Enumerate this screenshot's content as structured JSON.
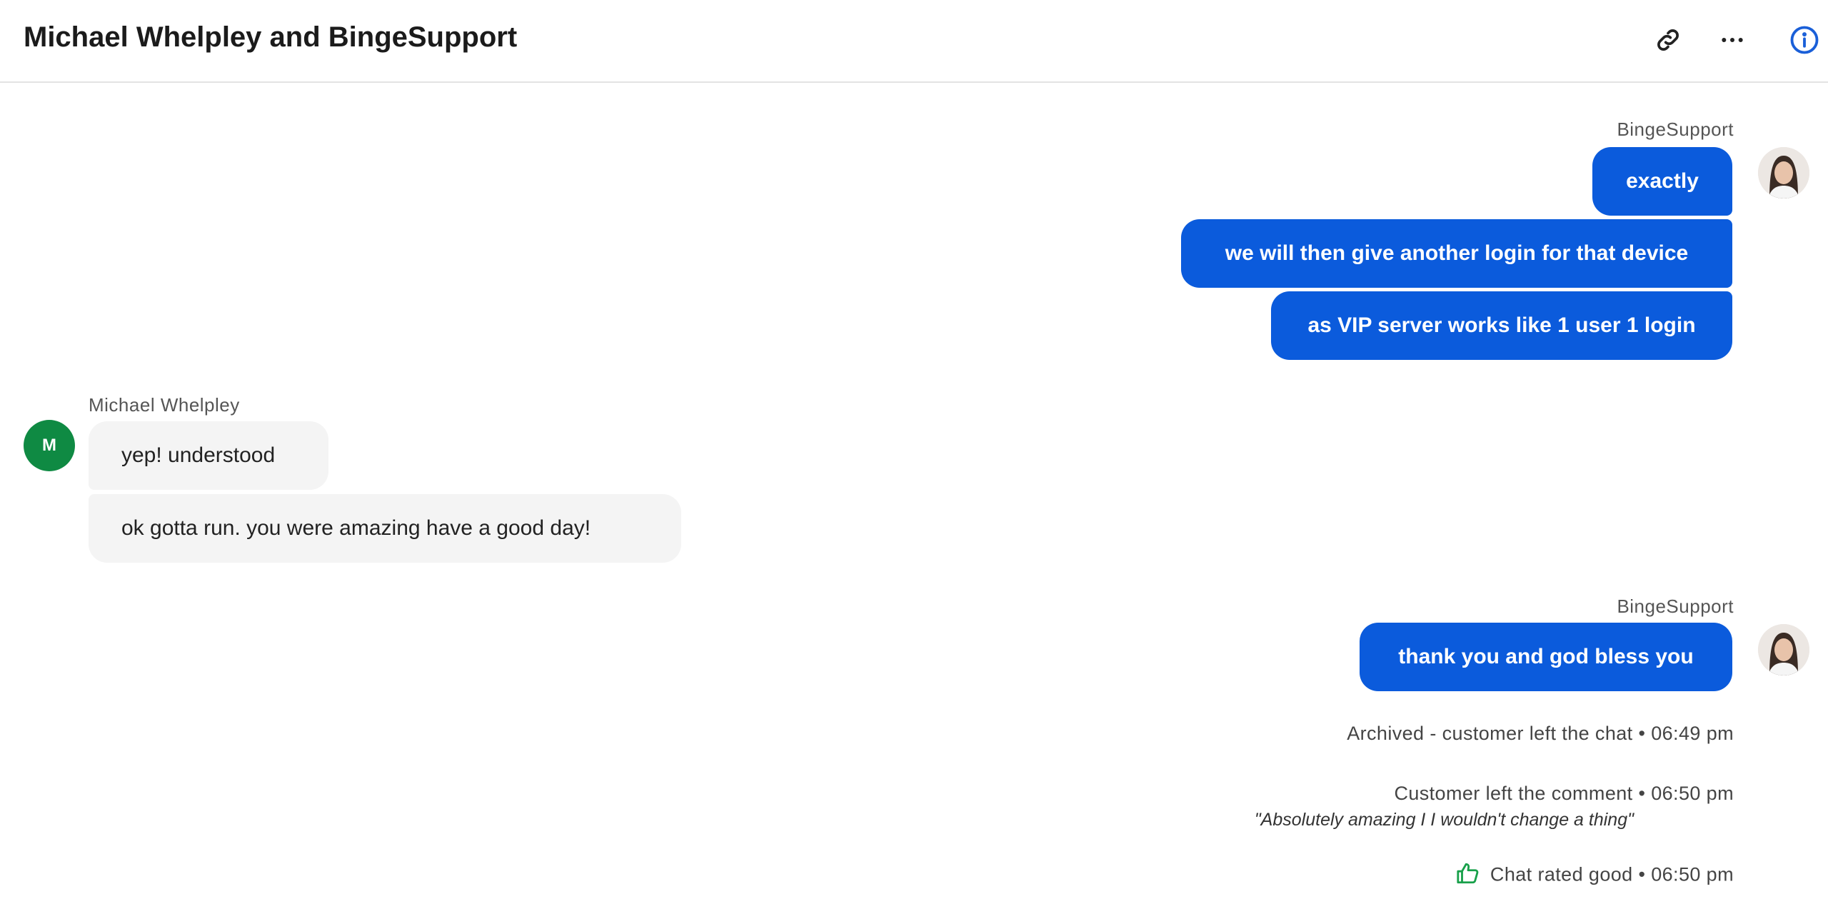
{
  "header": {
    "title": "Michael Whelpley and BingeSupport",
    "icons": [
      "link-icon",
      "more-icon",
      "info-icon"
    ],
    "info_color": "#1a5fd8"
  },
  "colors": {
    "agent_bubble": "#0b5bdc",
    "customer_bubble": "#f4f4f4",
    "customer_avatar": "#0f8a43",
    "rating_good": "#18a04a"
  },
  "messages": {
    "group1": {
      "sender": "BingeSupport",
      "lines": [
        "exactly",
        "we will then give another login for that device",
        "as VIP server works like 1 user 1 login"
      ]
    },
    "group2": {
      "sender": "Michael Whelpley",
      "avatar_initial": "M",
      "lines": [
        "yep! understood",
        "ok gotta run. you were amazing have a good day!"
      ]
    },
    "group3": {
      "sender": "BingeSupport",
      "lines": [
        "thank you and god bless you"
      ]
    }
  },
  "events": {
    "archived": "Archived - customer left the chat • 06:49 pm",
    "comment_header": "Customer left the comment • 06:50 pm",
    "comment_text": "\"Absolutely amazing I I wouldn't change a thing\"",
    "rating": "Chat rated good • 06:50 pm",
    "rating_icon": "thumbs-up-icon"
  }
}
